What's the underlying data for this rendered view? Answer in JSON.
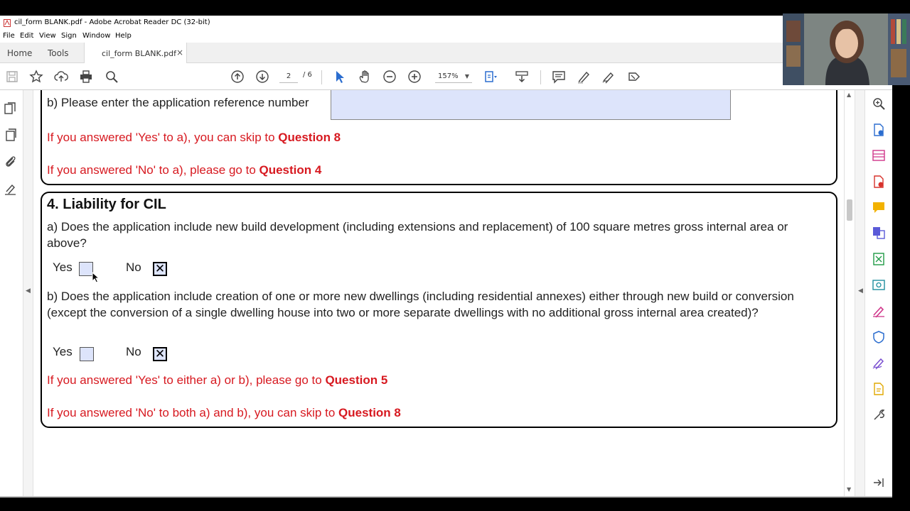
{
  "window": {
    "title": "cil_form BLANK.pdf - Adobe Acrobat Reader DC (32-bit)"
  },
  "menu": [
    "File",
    "Edit",
    "View",
    "Sign",
    "Window",
    "Help"
  ],
  "tabs": {
    "home": "Home",
    "tools": "Tools",
    "document": "cil_form BLANK.pdf",
    "close": "×"
  },
  "toolbar": {
    "page_current": "2",
    "page_total": "/ 6",
    "zoom": "157%",
    "icons": [
      "save-icon",
      "bookmark-star-icon",
      "upload-cloud-icon",
      "print-icon",
      "search-icon",
      "page-up-icon",
      "page-down-icon",
      "select-cursor-icon",
      "hand-icon",
      "zoom-out-icon",
      "zoom-in-icon",
      "fit-page-icon",
      "scroll-mode-icon",
      "comment-icon",
      "highlight-pen-icon",
      "sign-icon",
      "more-tools-icon"
    ]
  },
  "document": {
    "q3": {
      "b_label": "b) Please enter the application reference number",
      "note_yes_prefix": "If you answered 'Yes' to  a), you can skip to ",
      "note_yes_target": "Question 8",
      "note_no_prefix": "If you answered 'No' to a), please go to ",
      "note_no_target": "Question 4"
    },
    "q4": {
      "heading": "4. Liability  for CIL",
      "a_question": "a) Does the application include new build development (including extensions and replacement) of 100 square metres gross internal area or above?",
      "b_question": "b) Does the application include creation of one or more new dwellings (including residential annexes) either through new build or conversion (except the conversion of a single dwelling house into two or more separate dwellings with no additional gross internal area created)?",
      "yes_label": "Yes",
      "no_label": "No",
      "a_yes_checked": false,
      "a_no_checked": true,
      "b_yes_checked": false,
      "b_no_checked": true,
      "check_mark": "✕",
      "note_yes_prefix": "If you answered 'Yes' to either a) or b), please go to ",
      "note_yes_target": "Question 5",
      "note_no_prefix": "If you answered 'No' to both a) and b), you can skip to ",
      "note_no_target": "Question 8"
    }
  },
  "colors": {
    "instruction_red": "#d71920",
    "field_fill": "#dde4fb",
    "acrobat_red": "#d7322c",
    "tool_blue": "#2b6dcf"
  }
}
